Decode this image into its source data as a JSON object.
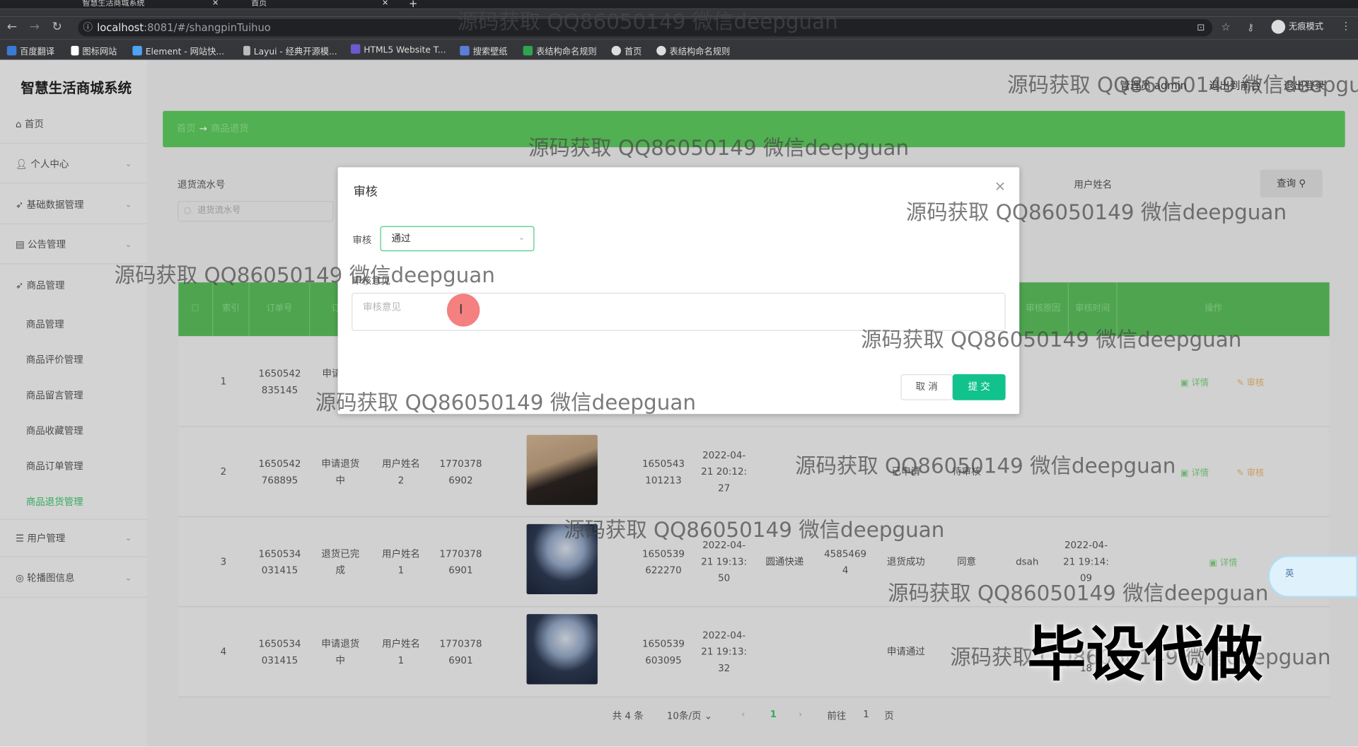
{
  "browser": {
    "tabs": [
      "智慧生活商城系统",
      "首页"
    ],
    "url_host": "localhost",
    "url_rest": ":8081/#/shangpinTuihuo",
    "bookmarks": [
      "百度翻译",
      "图标网站",
      "Element - 网站快...",
      "Layui - 经典开源模...",
      "HTML5 Website T...",
      "搜索壁纸",
      "表结构命名规则",
      "首页",
      "表结构命名规则"
    ],
    "incognito": "无痕模式"
  },
  "app": {
    "brand": "智慧生活商城系统",
    "top_user": "管理员 admin",
    "top_exit_to_front": "退出到前台",
    "top_logout": "退出登录"
  },
  "sidebar": {
    "items": [
      {
        "label": "首页",
        "icon": "home-icon"
      },
      {
        "label": "个人中心",
        "icon": "user-icon"
      },
      {
        "label": "基础数据管理",
        "icon": "send-icon"
      },
      {
        "label": "公告管理",
        "icon": "notice-icon"
      },
      {
        "label": "商品管理",
        "icon": "send-icon"
      }
    ],
    "sub_items": [
      "商品管理",
      "商品评价管理",
      "商品留言管理",
      "商品收藏管理",
      "商品订单管理",
      "商品退货管理"
    ],
    "bottom_items": [
      {
        "label": "用户管理",
        "icon": "list-icon"
      },
      {
        "label": "轮播图信息",
        "icon": "image-icon"
      }
    ]
  },
  "breadcrumb": {
    "home": "首页",
    "arrow": "→",
    "current": "商品退货"
  },
  "filters": {
    "return_no_label": "退货流水号",
    "return_no_placeholder": "退货流水号",
    "username_label": "用户姓名",
    "query_button": "查询"
  },
  "table": {
    "headers": [
      "",
      "索引",
      "订单号",
      "订单",
      "",
      "",
      "",
      "",
      "",
      "",
      "",
      "",
      "审核原因",
      "审核时间",
      "操作"
    ],
    "rows": [
      {
        "index": "1",
        "order_no_1": "1650542",
        "order_no_2": "835145",
        "status_1": "申请",
        "status_2": "",
        "user_1": "",
        "user_2": "",
        "phone_1": "",
        "phone_2": "",
        "return_no_1": "",
        "return_no_2": "",
        "date_1": "",
        "date_2": "",
        "date_3": "",
        "express": "",
        "express_no_1": "",
        "express_no_2": "",
        "result": "",
        "reason": "",
        "note": "",
        "audit_1": "",
        "audit_2": "",
        "audit_3": "",
        "has_image": false,
        "actions": [
          "详情",
          "审核"
        ]
      },
      {
        "index": "2",
        "order_no_1": "1650542",
        "order_no_2": "768895",
        "status_1": "申请退货",
        "status_2": "中",
        "user_1": "用户姓名",
        "user_2": "2",
        "phone_1": "1770378",
        "phone_2": "6902",
        "return_no_1": "1650543",
        "return_no_2": "101213",
        "date_1": "2022-04-",
        "date_2": "21 20:12:",
        "date_3": "27",
        "express": "",
        "express_no_1": "",
        "express_no_2": "",
        "result": "已申请",
        "reason": "待审核",
        "note": "",
        "audit_1": "",
        "audit_2": "",
        "audit_3": "",
        "has_image": true,
        "actions": [
          "详情",
          "审核"
        ]
      },
      {
        "index": "3",
        "order_no_1": "1650534",
        "order_no_2": "031415",
        "status_1": "退货已完",
        "status_2": "成",
        "user_1": "用户姓名",
        "user_2": "1",
        "phone_1": "1770378",
        "phone_2": "6901",
        "return_no_1": "1650539",
        "return_no_2": "622270",
        "date_1": "2022-04-",
        "date_2": "21 19:13:",
        "date_3": "50",
        "express": "圆通快递",
        "express_no_1": "4585469",
        "express_no_2": "4",
        "result": "退货成功",
        "reason": "同意",
        "note": "dsah",
        "audit_1": "2022-04-",
        "audit_2": "21 19:14:",
        "audit_3": "09",
        "has_image": true,
        "actions": [
          "详情"
        ]
      },
      {
        "index": "4",
        "order_no_1": "1650534",
        "order_no_2": "031415",
        "status_1": "申请退货",
        "status_2": "中",
        "user_1": "用户姓名",
        "user_2": "1",
        "phone_1": "1770378",
        "phone_2": "6901",
        "return_no_1": "1650539",
        "return_no_2": "603095",
        "date_1": "2022-04-",
        "date_2": "21 19:13:",
        "date_3": "32",
        "express": "",
        "express_no_1": "",
        "express_no_2": "",
        "result": "申请通过",
        "reason": "",
        "note": "",
        "audit_1": "",
        "audit_2": "",
        "audit_3": "18",
        "has_image": true,
        "actions": []
      }
    ]
  },
  "pagination": {
    "total": "共 4 条",
    "page_size": "10条/页",
    "current": "1",
    "goto_label": "前往",
    "goto_value": "1",
    "page_suffix": "页"
  },
  "modal": {
    "title": "审核",
    "audit_label": "审核",
    "audit_value": "通过",
    "opinion_label": "审核意见",
    "opinion_placeholder": "审核意见",
    "cancel": "取 消",
    "submit": "提 交"
  },
  "overlays": {
    "watermark": "源码获取 QQ86050149 微信deepguan",
    "banner": "毕设代做",
    "ime_label": "英"
  },
  "colors": {
    "accent": "#12c28d",
    "header_green": "#58b858",
    "crumb_green": "#5bc45b",
    "active_menu": "#3bbf6c"
  }
}
